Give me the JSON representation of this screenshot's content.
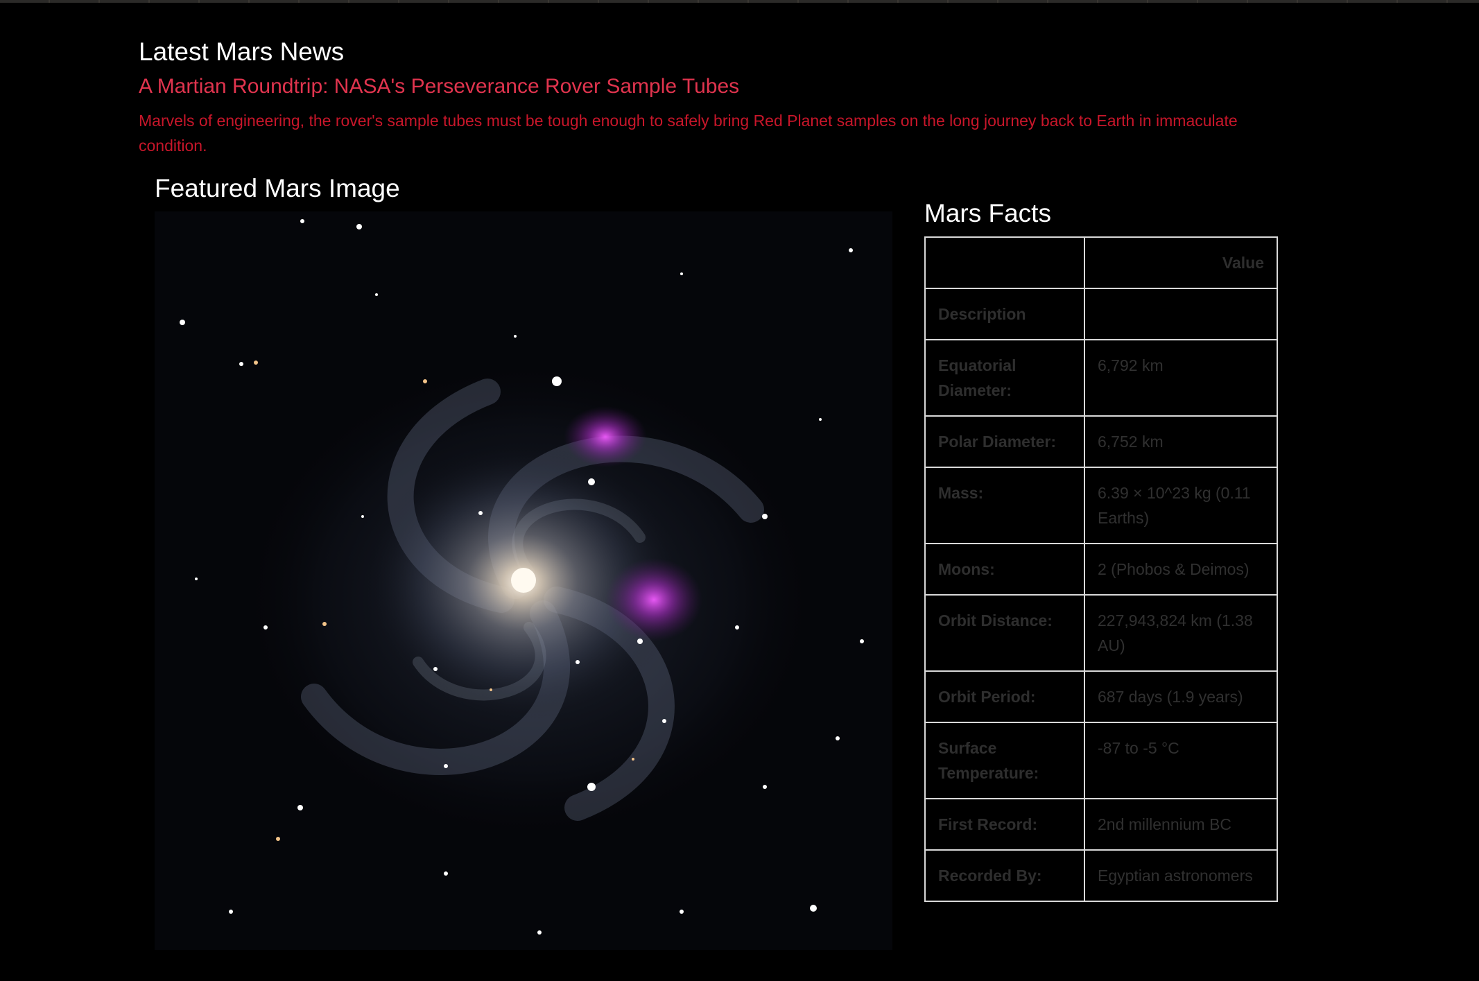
{
  "news": {
    "heading": "Latest Mars News",
    "title": "A Martian Roundtrip: NASA's Perseverance Rover Sample Tubes",
    "teaser": "Marvels of engineering, the rover's sample tubes must be tough enough to safely bring Red Planet samples on the long journey back to Earth in immaculate condition."
  },
  "featured_image": {
    "heading": "Featured Mars Image"
  },
  "facts": {
    "heading": "Mars Facts",
    "columns": [
      "",
      "Value"
    ],
    "rows": [
      {
        "label": "Description",
        "value": ""
      },
      {
        "label": "Equatorial Diameter:",
        "value": "6,792 km"
      },
      {
        "label": "Polar Diameter:",
        "value": "6,752 km"
      },
      {
        "label": "Mass:",
        "value": "6.39 × 10^23 kg (0.11 Earths)"
      },
      {
        "label": "Moons:",
        "value": "2 (Phobos & Deimos)"
      },
      {
        "label": "Orbit Distance:",
        "value": "227,943,824 km (1.38 AU)"
      },
      {
        "label": "Orbit Period:",
        "value": "687 days (1.9 years)"
      },
      {
        "label": "Surface Temperature:",
        "value": "-87 to -5 °C"
      },
      {
        "label": "First Record:",
        "value": "2nd millennium BC"
      },
      {
        "label": "Recorded By:",
        "value": "Egyptian astronomers"
      }
    ]
  },
  "colors": {
    "background": "#000000",
    "heading": "#ffffff",
    "news_title": "#e0344e",
    "news_teaser": "#c8162a",
    "table_border": "#d9d9d9",
    "table_text": "#2e2e2e"
  }
}
